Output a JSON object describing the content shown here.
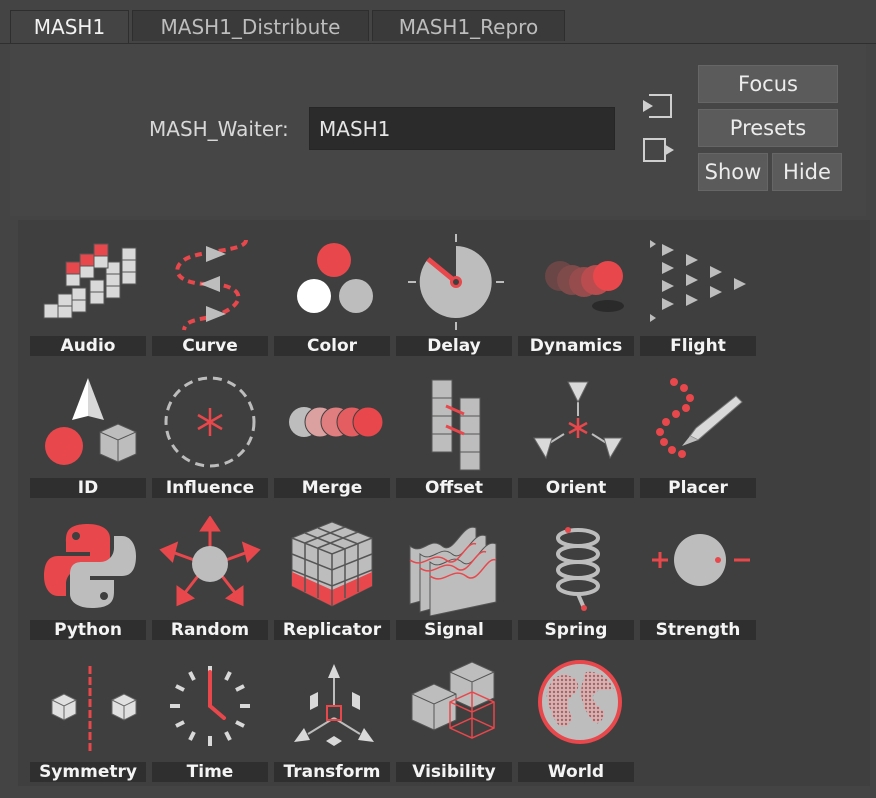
{
  "tabs": [
    {
      "label": "MASH1",
      "active": true
    },
    {
      "label": "MASH1_Distribute",
      "active": false
    },
    {
      "label": "MASH1_Repro",
      "active": false
    }
  ],
  "waiter": {
    "label": "MASH_Waiter:",
    "value": "MASH1"
  },
  "buttons": {
    "focus": "Focus",
    "presets": "Presets",
    "show": "Show",
    "hide": "Hide"
  },
  "nodes": [
    {
      "label": "Audio",
      "icon": "audio-icon"
    },
    {
      "label": "Curve",
      "icon": "curve-icon"
    },
    {
      "label": "Color",
      "icon": "color-icon"
    },
    {
      "label": "Delay",
      "icon": "delay-icon"
    },
    {
      "label": "Dynamics",
      "icon": "dynamics-icon"
    },
    {
      "label": "Flight",
      "icon": "flight-icon"
    },
    {
      "label": "ID",
      "icon": "id-icon"
    },
    {
      "label": "Influence",
      "icon": "influence-icon"
    },
    {
      "label": "Merge",
      "icon": "merge-icon"
    },
    {
      "label": "Offset",
      "icon": "offset-icon"
    },
    {
      "label": "Orient",
      "icon": "orient-icon"
    },
    {
      "label": "Placer",
      "icon": "placer-icon"
    },
    {
      "label": "Python",
      "icon": "python-icon"
    },
    {
      "label": "Random",
      "icon": "random-icon"
    },
    {
      "label": "Replicator",
      "icon": "replicator-icon"
    },
    {
      "label": "Signal",
      "icon": "signal-icon"
    },
    {
      "label": "Spring",
      "icon": "spring-icon"
    },
    {
      "label": "Strength",
      "icon": "strength-icon"
    },
    {
      "label": "Symmetry",
      "icon": "symmetry-icon"
    },
    {
      "label": "Time",
      "icon": "time-icon"
    },
    {
      "label": "Transform",
      "icon": "transform-icon"
    },
    {
      "label": "Visibility",
      "icon": "visibility-icon"
    },
    {
      "label": "World",
      "icon": "world-icon"
    }
  ],
  "colors": {
    "accent": "#e8474b",
    "icon_gray": "#bdbdbd",
    "background": "#444444"
  }
}
